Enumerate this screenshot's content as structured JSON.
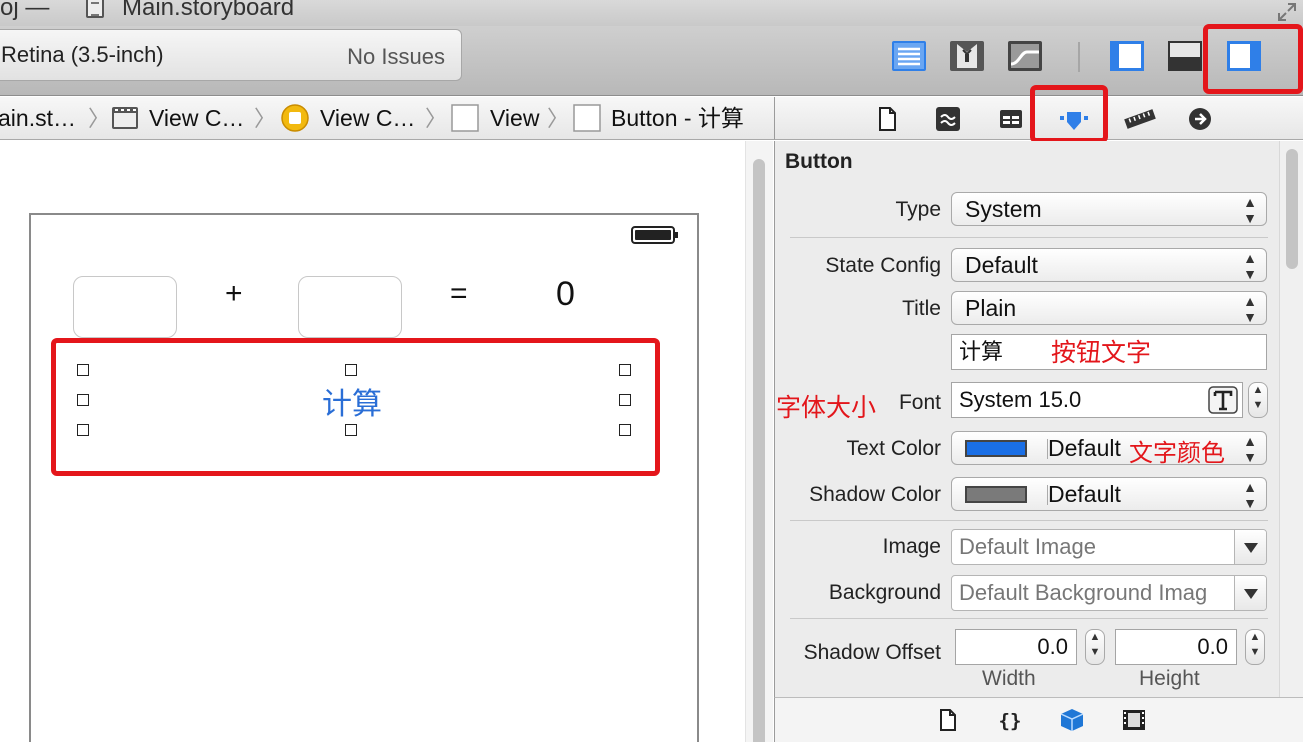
{
  "window": {
    "title_fragment": "oj —",
    "filename": "Main.storyboard"
  },
  "toolbar": {
    "scheme": "Retina (3.5-inch)",
    "issues": "No Issues",
    "icons": [
      "editor-standard-icon",
      "editor-assistant-icon",
      "editor-version-icon",
      "navigator-panel-icon",
      "debug-panel-icon",
      "utilities-panel-icon"
    ],
    "accent": "#2f7fe8"
  },
  "jumpbar": {
    "crumbs": [
      "ain.st…",
      "View C…",
      "View C…",
      "View",
      "Button - 计算"
    ]
  },
  "canvas": {
    "field1": "",
    "plus": "+",
    "field2": "",
    "equals": "=",
    "result": "0",
    "button_title": "计算",
    "button_color": "#2a6ed6"
  },
  "inspector": {
    "section": "Button",
    "type": {
      "label": "Type",
      "value": "System"
    },
    "state_config": {
      "label": "State Config",
      "value": "Default"
    },
    "title": {
      "label": "Title",
      "value": "Plain"
    },
    "title_text": "计算",
    "font": {
      "label": "Font",
      "value": "System 15.0"
    },
    "text_color": {
      "label": "Text Color",
      "value": "Default",
      "swatch": "#1a6fe6"
    },
    "shadow_color": {
      "label": "Shadow Color",
      "value": "Default",
      "swatch": "#7a7a7a"
    },
    "image": {
      "label": "Image",
      "placeholder": "Default Image"
    },
    "background": {
      "label": "Background",
      "placeholder": "Default Background Imag"
    },
    "shadow_offset": {
      "label": "Shadow Offset",
      "width": "0.0",
      "height": "0.0",
      "width_label": "Width",
      "height_label": "Height"
    }
  },
  "annotations": {
    "button_text": "按钮文字",
    "font_size": "字体大小",
    "text_color": "文字颜色",
    "color": "#e3161b"
  },
  "library": {
    "icons": [
      "file-template-icon",
      "code-snippet-icon",
      "object-library-icon",
      "media-library-icon"
    ]
  }
}
